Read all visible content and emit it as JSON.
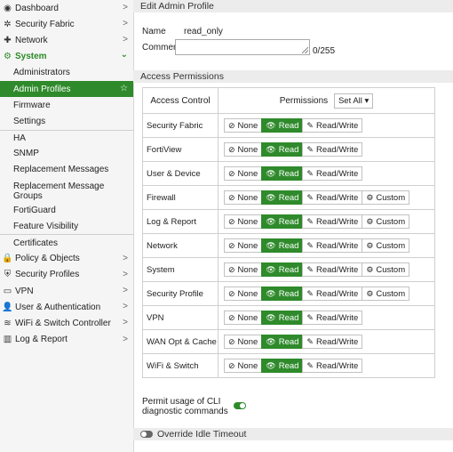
{
  "sidebar": {
    "items": [
      {
        "label": "Dashboard",
        "icon": "dashboard-icon",
        "glyph": "◉"
      },
      {
        "label": "Security Fabric",
        "icon": "security-fabric-icon",
        "glyph": "✲"
      },
      {
        "label": "Network",
        "icon": "network-icon",
        "glyph": "✚"
      },
      {
        "label": "System",
        "icon": "gear-icon",
        "glyph": "⚙"
      },
      {
        "label": "Administrators"
      },
      {
        "label": "Admin Profiles"
      },
      {
        "label": "Firmware"
      },
      {
        "label": "Settings"
      },
      {
        "label": "HA"
      },
      {
        "label": "SNMP"
      },
      {
        "label": "Replacement Messages"
      },
      {
        "label": "Replacement Message Groups"
      },
      {
        "label": "FortiGuard"
      },
      {
        "label": "Feature Visibility"
      },
      {
        "label": "Certificates"
      },
      {
        "label": "Policy & Objects",
        "icon": "lock-icon",
        "glyph": "🔒"
      },
      {
        "label": "Security Profiles",
        "icon": "shield-icon",
        "glyph": "⛨"
      },
      {
        "label": "VPN",
        "icon": "monitor-icon",
        "glyph": "▭"
      },
      {
        "label": "User & Authentication",
        "icon": "user-icon",
        "glyph": "👤"
      },
      {
        "label": "WiFi & Switch Controller",
        "icon": "wifi-icon",
        "glyph": "≋"
      },
      {
        "label": "Log & Report",
        "icon": "chart-icon",
        "glyph": "▥"
      }
    ],
    "chevron": ">",
    "chevron_down": "⌄",
    "star": "☆"
  },
  "header": {
    "title": "Edit Admin Profile"
  },
  "form": {
    "name_label": "Name",
    "name_value": "read_only",
    "comments_label": "Comments",
    "comments_counter": "0/255"
  },
  "access": {
    "section_title": "Access Permissions",
    "col_access": "Access Control",
    "col_permissions": "Permissions",
    "set_all": "Set All ▾",
    "none_label": "None",
    "read_label": "Read",
    "rw_label": "Read/Write",
    "custom_label": "Custom",
    "rows": [
      {
        "name": "Security Fabric",
        "custom": false
      },
      {
        "name": "FortiView",
        "custom": false
      },
      {
        "name": "User & Device",
        "custom": false
      },
      {
        "name": "Firewall",
        "custom": true
      },
      {
        "name": "Log & Report",
        "custom": true
      },
      {
        "name": "Network",
        "custom": true
      },
      {
        "name": "System",
        "custom": true
      },
      {
        "name": "Security Profile",
        "custom": true
      },
      {
        "name": "VPN",
        "custom": false
      },
      {
        "name": "WAN Opt & Cache",
        "custom": false
      },
      {
        "name": "WiFi & Switch",
        "custom": false
      }
    ],
    "selected": "read"
  },
  "cli": {
    "label": "Permit usage of CLI diagnostic commands",
    "enabled": true
  },
  "idle": {
    "label": "Override Idle Timeout",
    "enabled": false
  },
  "colors": {
    "accent": "#2f8a2b"
  }
}
